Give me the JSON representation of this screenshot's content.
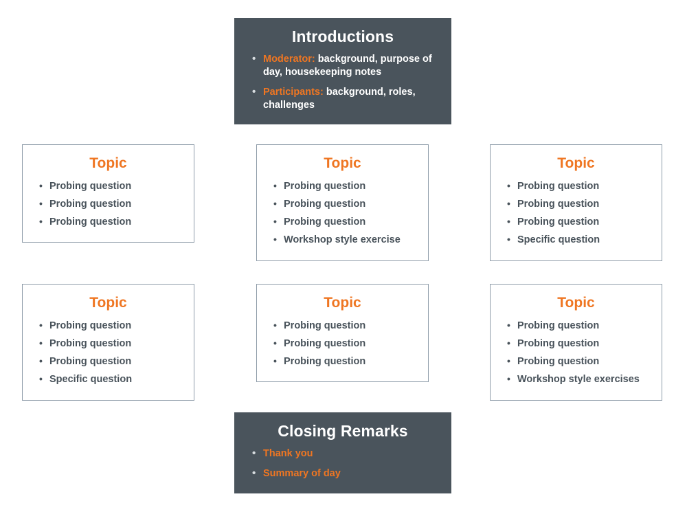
{
  "colors": {
    "accent": "#ef7622",
    "panel_dark_bg": "#4a545c",
    "card_border": "#8d9ba8",
    "body_text": "#48525a",
    "panel_text": "#ffffff",
    "page_bg": "#ffffff"
  },
  "intro_panel": {
    "title": "Introductions",
    "bullets": [
      {
        "lead": "Moderator:",
        "rest": " background, purpose of day, housekeeping notes"
      },
      {
        "lead": "Participants:",
        "rest": " background, roles, challenges"
      }
    ]
  },
  "closing_panel": {
    "title": "Closing Remarks",
    "bullets": [
      "Thank you",
      "Summary of day"
    ]
  },
  "topic_cards": [
    {
      "title": "Topic",
      "bullets": [
        "Probing question",
        "Probing question",
        "Probing question"
      ]
    },
    {
      "title": "Topic",
      "bullets": [
        "Probing question",
        "Probing question",
        "Probing question",
        "Workshop style exercise"
      ]
    },
    {
      "title": "Topic",
      "bullets": [
        "Probing question",
        "Probing question",
        "Probing question",
        "Specific question"
      ]
    },
    {
      "title": "Topic",
      "bullets": [
        "Probing question",
        "Probing question",
        "Probing question",
        "Specific question"
      ]
    },
    {
      "title": "Topic",
      "bullets": [
        "Probing question",
        "Probing question",
        "Probing question"
      ]
    },
    {
      "title": "Topic",
      "bullets": [
        "Probing question",
        "Probing question",
        "Probing question",
        "Workshop style exercises"
      ]
    }
  ]
}
